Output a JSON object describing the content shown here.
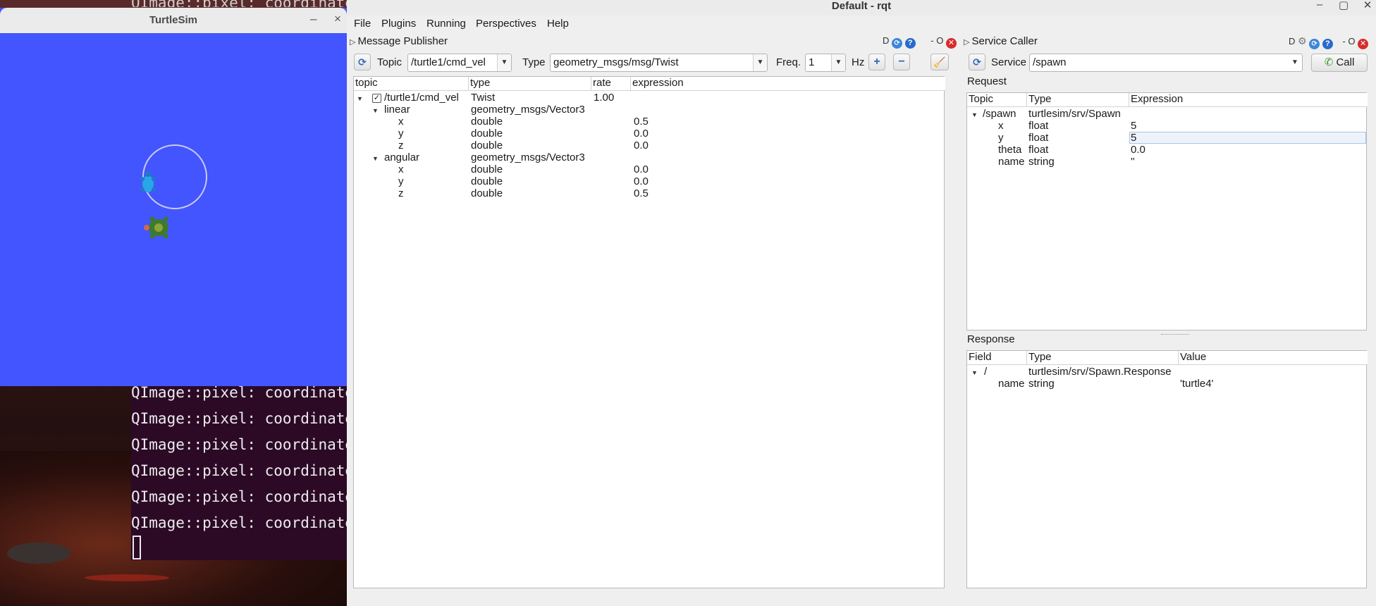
{
  "terminal": {
    "partial_top_line": "QImage::pixel: coordinate",
    "lines": [
      "QImage::pixel: coordinate",
      "QImage::pixel: coordinate",
      "QImage::pixel: coordinate",
      "QImage::pixel: coordinate",
      "QImage::pixel: coordinate",
      "QImage::pixel: coordinate"
    ]
  },
  "turtlesim": {
    "title": "TurtleSim",
    "minimize_glyph": "–",
    "close_glyph": "×",
    "background_color": "#4355fe"
  },
  "rqt": {
    "title": "Default - rqt",
    "menu": [
      {
        "label": "File"
      },
      {
        "label": "Plugins"
      },
      {
        "label": "Running"
      },
      {
        "label": "Perspectives"
      },
      {
        "label": "Help"
      }
    ]
  },
  "message_publisher": {
    "title": "Message Publisher",
    "icons_text": "D",
    "dash_o": "- O",
    "topic_label": "Topic",
    "topic_value": "/turtle1/cmd_vel",
    "type_label": "Type",
    "type_value": "geometry_msgs/msg/Twist",
    "freq_label": "Freq.",
    "freq_value": "1",
    "hz_label": "Hz",
    "columns": [
      "topic",
      "type",
      "rate",
      "expression"
    ],
    "rows": [
      {
        "name": "/turtle1/cmd_vel",
        "type": "Twist",
        "rate": "1.00",
        "expression": "",
        "checked": true
      },
      {
        "name": "linear",
        "type": "geometry_msgs/Vector3",
        "rate": "",
        "expression": ""
      },
      {
        "name": "x",
        "type": "double",
        "rate": "",
        "expression": "0.5"
      },
      {
        "name": "y",
        "type": "double",
        "rate": "",
        "expression": "0.0"
      },
      {
        "name": "z",
        "type": "double",
        "rate": "",
        "expression": "0.0"
      },
      {
        "name": "angular",
        "type": "geometry_msgs/Vector3",
        "rate": "",
        "expression": ""
      },
      {
        "name": "x",
        "type": "double",
        "rate": "",
        "expression": "0.0"
      },
      {
        "name": "y",
        "type": "double",
        "rate": "",
        "expression": "0.0"
      },
      {
        "name": "z",
        "type": "double",
        "rate": "",
        "expression": "0.5"
      }
    ]
  },
  "service_caller": {
    "title": "Service Caller",
    "icons_text": "D",
    "dash_o": "- O",
    "service_label": "Service",
    "service_value": "/spawn",
    "call_label": "Call",
    "request_label": "Request",
    "request_columns": [
      "Topic",
      "Type",
      "Expression"
    ],
    "request_rows": [
      {
        "name": "/spawn",
        "type": "turtlesim/srv/Spawn",
        "expression": ""
      },
      {
        "name": "x",
        "type": "float",
        "expression": "5"
      },
      {
        "name": "y",
        "type": "float",
        "expression": "5"
      },
      {
        "name": "theta",
        "type": "float",
        "expression": "0.0"
      },
      {
        "name": "name",
        "type": "string",
        "expression": "''"
      }
    ],
    "response_label": "Response",
    "response_columns": [
      "Field",
      "Type",
      "Value"
    ],
    "response_rows": [
      {
        "name": "/",
        "type": "turtlesim/srv/Spawn.Response",
        "value": ""
      },
      {
        "name": "name",
        "type": "string",
        "value": "'turtle4'"
      }
    ]
  }
}
